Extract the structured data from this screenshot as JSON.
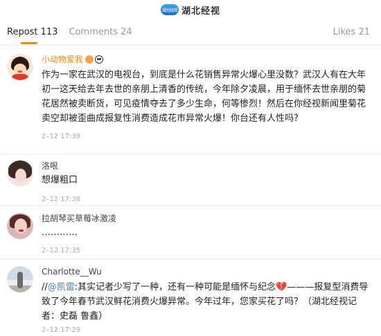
{
  "header": {
    "brand_logo_text": "湖北经视",
    "brand_name": "湖北经视"
  },
  "tabs": {
    "repost": "Repost 113",
    "comments": "Comments 24",
    "likes": "Likes 21"
  },
  "colors": {
    "accent": "#ff8200",
    "vip_name": "#f28a00",
    "mention": "#4a7fbf"
  },
  "comments": [
    {
      "username": "小动物爱我",
      "text": "作为一家在武汉的电视台，到底是什么花销售异常火爆心里没数？武汉人有在大年初一这天给去年去世的亲朋上清香的传统，今年除夕凌晨，用于缅怀去世亲朋的菊花居然被卖断货，可见疫情夺去了多少生命，何等惨烈！然后在你经视新闻里菊花卖空却被歪曲成报复性消费造成花市异常火爆！你台还有人性吗?",
      "time": "2–12 17:39"
    },
    {
      "username": "洛哏",
      "text": "想爆粗口",
      "time": "2–12 17:38"
    },
    {
      "username": "拉胡琴买草莓冰激凌",
      "text": "…………",
      "time": "2–12 17:35"
    },
    {
      "username": "Charlotte__Wu",
      "text_prefix": "//",
      "mention": "@凯雷",
      "text_mid": ":其实记者少写了一种，还有一种可能是缅怀与纪念",
      "heart": "💔",
      "text_tail": "———报复型消费导致了今年春节武汉鲜花消费火爆异常。今年过年，您家买花了吗？（湖北经视记者：史磊 鲁鑫）",
      "time": "2–12 17:29"
    }
  ]
}
